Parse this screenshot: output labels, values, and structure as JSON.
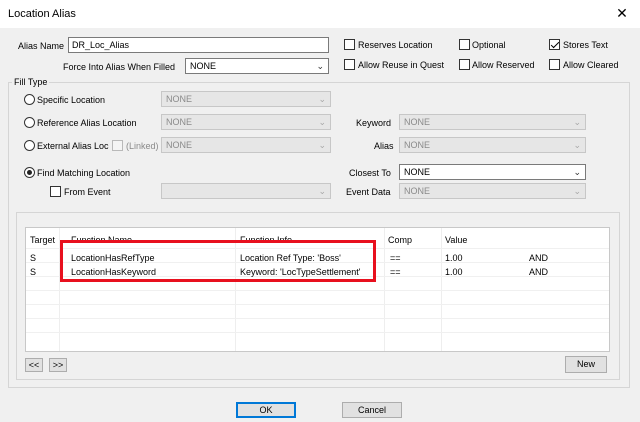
{
  "window": {
    "title": "Location Alias",
    "close_glyph": "✕"
  },
  "alias_name": {
    "label": "Alias Name",
    "value": "DR_Loc_Alias"
  },
  "force_into_alias": {
    "label": "Force Into Alias When Filled",
    "value": "NONE"
  },
  "flags": {
    "reserves_location": {
      "label": "Reserves Location",
      "checked": false
    },
    "optional": {
      "label": "Optional",
      "checked": false
    },
    "stores_text": {
      "label": "Stores Text",
      "checked": true
    },
    "allow_reuse": {
      "label": "Allow Reuse in Quest",
      "checked": false
    },
    "allow_reserved": {
      "label": "Allow Reserved",
      "checked": false
    },
    "allow_cleared": {
      "label": "Allow Cleared",
      "checked": false
    }
  },
  "fill_type": {
    "label": "Fill Type",
    "specific_location": {
      "label": "Specific Location",
      "value": "NONE",
      "selected": false
    },
    "reference_alias_location": {
      "label": "Reference Alias Location",
      "value": "NONE",
      "selected": false
    },
    "external_alias_loc": {
      "label": "External Alias Loc",
      "linked_label": "(Linked)",
      "value": "NONE",
      "selected": false
    },
    "find_matching_location": {
      "label": "Find Matching Location",
      "selected": true
    },
    "from_event": {
      "label": "From Event",
      "value": ""
    },
    "keyword": {
      "label": "Keyword",
      "value": "NONE"
    },
    "alias": {
      "label": "Alias",
      "value": "NONE"
    },
    "closest_to": {
      "label": "Closest To",
      "value": "NONE"
    },
    "event_data": {
      "label": "Event Data",
      "value": "NONE"
    }
  },
  "conditions": {
    "headers": {
      "target": "Target",
      "function_name": "Function Name",
      "function_info": "Function Info",
      "comp": "Comp",
      "value": "Value"
    },
    "rows": [
      {
        "target": "S",
        "function_name": "LocationHasRefType",
        "function_info": "Location Ref Type: 'Boss'",
        "comp": "==",
        "value": "1.00",
        "connector": "AND"
      },
      {
        "target": "S",
        "function_name": "LocationHasKeyword",
        "function_info": "Keyword: 'LocTypeSettlement'",
        "comp": "==",
        "value": "1.00",
        "connector": "AND"
      }
    ],
    "highlight_color": "#e8101e"
  },
  "buttons": {
    "scroll_left": "<<",
    "scroll_right": ">>",
    "new": "New",
    "ok": "OK",
    "cancel": "Cancel"
  }
}
